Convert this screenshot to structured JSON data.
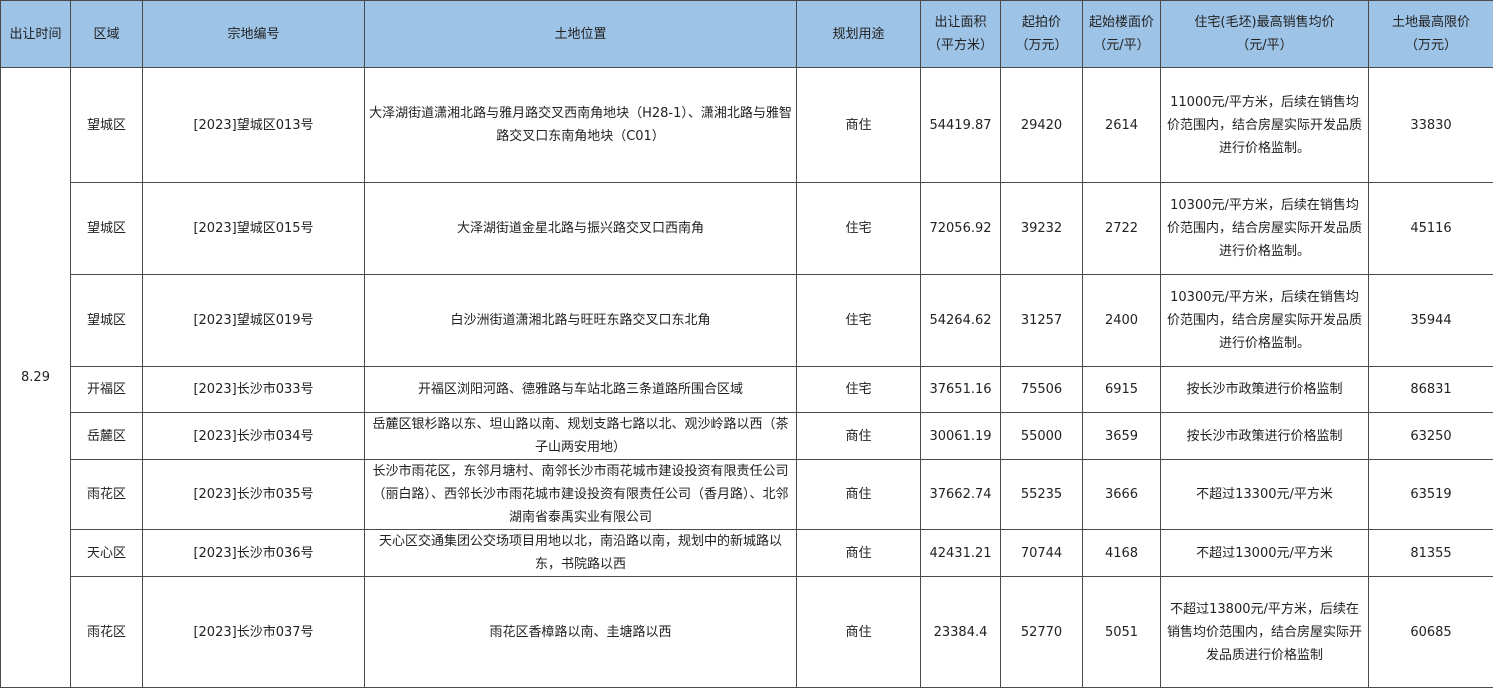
{
  "headers": [
    "出让时间",
    "区域",
    "宗地编号",
    "土地位置",
    "规划用途",
    "出让面积\n（平方米）",
    "起拍价\n（万元）",
    "起始楼面价\n（元/平）",
    "住宅(毛坯)最高销售均价\n（元/平）",
    "土地最高限价\n（万元）"
  ],
  "date": "8.29",
  "rows": [
    {
      "region": "望城区",
      "code": "[2023]望城区013号",
      "location": "大泽湖街道潇湘北路与雅月路交叉西南角地块（H28-1）、潇湘北路与雅智路交叉口东南角地块（C01）",
      "use": "商住",
      "area": "54419.87",
      "start_price": "29420",
      "floor_price": "2614",
      "max_sale": "11000元/平方米，后续在销售均价范围内，结合房屋实际开发品质进行价格监制。",
      "max_land": "33830"
    },
    {
      "region": "望城区",
      "code": "[2023]望城区015号",
      "location": "大泽湖街道金星北路与振兴路交叉口西南角",
      "use": "住宅",
      "area": "72056.92",
      "start_price": "39232",
      "floor_price": "2722",
      "max_sale": "10300元/平方米，后续在销售均价范围内，结合房屋实际开发品质进行价格监制。",
      "max_land": "45116"
    },
    {
      "region": "望城区",
      "code": "[2023]望城区019号",
      "location": "白沙洲街道潇湘北路与旺旺东路交叉口东北角",
      "use": "住宅",
      "area": "54264.62",
      "start_price": "31257",
      "floor_price": "2400",
      "max_sale": "10300元/平方米，后续在销售均价范围内，结合房屋实际开发品质进行价格监制。",
      "max_land": "35944"
    },
    {
      "region": "开福区",
      "code": "[2023]长沙市033号",
      "location": "开福区浏阳河路、德雅路与车站北路三条道路所围合区域",
      "use": "住宅",
      "area": "37651.16",
      "start_price": "75506",
      "floor_price": "6915",
      "max_sale": "按长沙市政策进行价格监制",
      "max_land": "86831"
    },
    {
      "region": "岳麓区",
      "code": "[2023]长沙市034号",
      "location": "岳麓区银杉路以东、坦山路以南、规划支路七路以北、观沙岭路以西（茶子山两安用地）",
      "use": "商住",
      "area": "30061.19",
      "start_price": "55000",
      "floor_price": "3659",
      "max_sale": "按长沙市政策进行价格监制",
      "max_land": "63250"
    },
    {
      "region": "雨花区",
      "code": "[2023]长沙市035号",
      "location": "长沙市雨花区，东邻月塘村、南邻长沙市雨花城市建设投资有限责任公司（丽白路）、西邻长沙市雨花城市建设投资有限责任公司（香月路）、北邻湖南省泰禹实业有限公司",
      "use": "商住",
      "area": "37662.74",
      "start_price": "55235",
      "floor_price": "3666",
      "max_sale": "不超过13300元/平方米",
      "max_land": "63519"
    },
    {
      "region": "天心区",
      "code": "[2023]长沙市036号",
      "location": "天心区交通集团公交场项目用地以北，南沿路以南，规划中的新城路以东，书院路以西",
      "use": "商住",
      "area": "42431.21",
      "start_price": "70744",
      "floor_price": "4168",
      "max_sale": "不超过13000元/平方米",
      "max_land": "81355"
    },
    {
      "region": "雨花区",
      "code": "[2023]长沙市037号",
      "location": "雨花区香樟路以南、圭塘路以西",
      "use": "商住",
      "area": "23384.4",
      "start_price": "52770",
      "floor_price": "5051",
      "max_sale": "不超过13800元/平方米，后续在销售均价范围内，结合房屋实际开发品质进行价格监制",
      "max_land": "60685"
    }
  ]
}
